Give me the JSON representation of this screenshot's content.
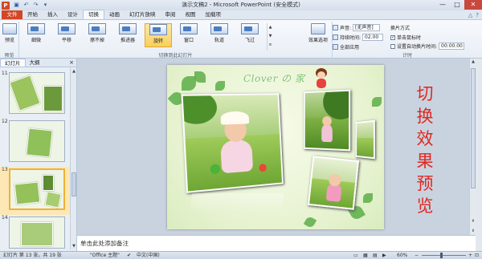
{
  "window": {
    "title": "演示文稿2 - Microsoft PowerPoint (安全模式)",
    "app_icon": "P",
    "controls": [
      "—",
      "□",
      "✕"
    ]
  },
  "tabs": {
    "file": "文件",
    "items": [
      "开始",
      "插入",
      "设计",
      "切换",
      "动画",
      "幻灯片放映",
      "审阅",
      "视图",
      "加载项"
    ],
    "active_index": 3
  },
  "ribbon": {
    "preview": {
      "label": "预览",
      "group": "预览"
    },
    "transitions": [
      "细微",
      "平移",
      "擦不掉",
      "推进器",
      "旋转",
      "窗口",
      "轨道",
      "飞过"
    ],
    "selected_transition": "旋转",
    "gallery_group": "切换到此幻灯片",
    "effect_options": "效果选项",
    "timing": {
      "sound_label": "声音:",
      "sound_value": "[无声音]",
      "duration_label": "持续时间:",
      "duration_value": "02.00",
      "apply_all": "全部应用",
      "advance_title": "换片方式",
      "on_click": "单击鼠标时",
      "after_label": "设置自动换片时间:",
      "after_value": "00:00.00",
      "group": "计时"
    }
  },
  "left_panel": {
    "tabs": [
      "幻灯片",
      "大纲"
    ],
    "close": "×",
    "slides": [
      {
        "num": "11"
      },
      {
        "num": "12"
      },
      {
        "num": "13"
      },
      {
        "num": "14"
      }
    ]
  },
  "slide": {
    "title": "Clover の 家",
    "side_text": "切换效果预览"
  },
  "notes_placeholder": "单击此处添加备注",
  "status": {
    "slide_info": "幻灯片 第 13 张，共 19 张",
    "theme": "\"Office 主题\"",
    "language": "中文(中国)",
    "zoom": "60%"
  },
  "colors": {
    "file_tab": "#d24726",
    "accent_selected": "#f9cf5d",
    "side_text": "#e0271f"
  }
}
